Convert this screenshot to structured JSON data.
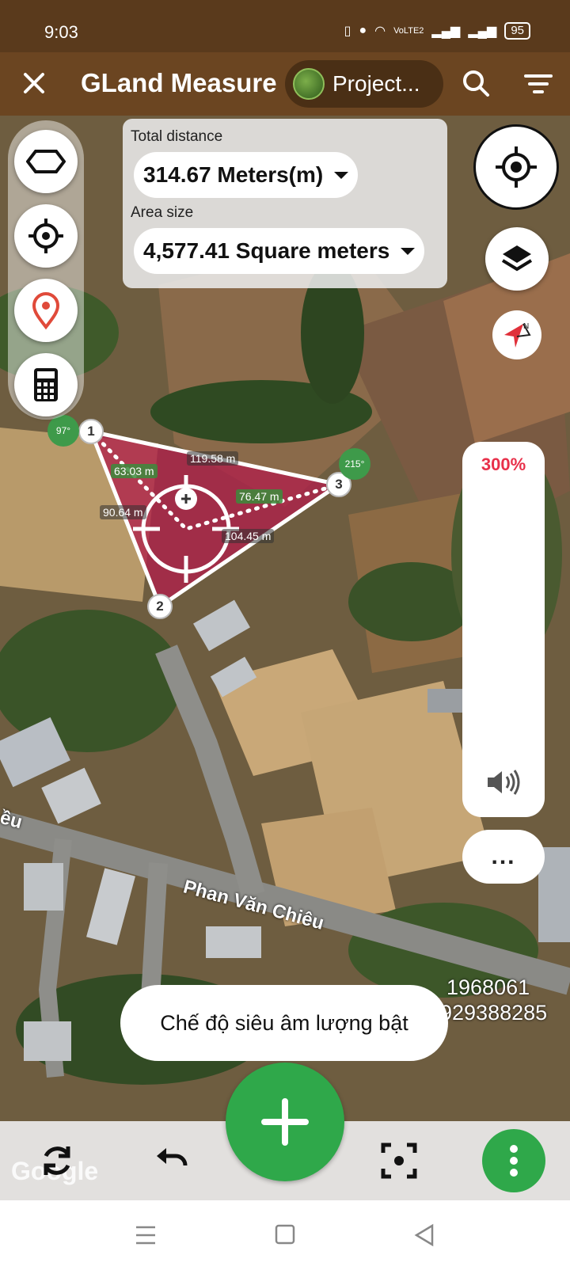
{
  "status_bar": {
    "time": "9:03",
    "network": "VoLTE2",
    "battery": "95"
  },
  "app_bar": {
    "title": "GLand Measure",
    "project_label": "Project..."
  },
  "measure": {
    "distance_label": "Total distance",
    "distance_value": "314.67 Meters(m)",
    "area_label": "Area size",
    "area_value": "4,577.41 Square meters"
  },
  "polygon": {
    "vertices": [
      {
        "label": "1",
        "angle": "97°"
      },
      {
        "label": "2",
        "angle": ""
      },
      {
        "label": "3",
        "angle": "215°"
      }
    ],
    "edge_lengths": [
      "119.58 m",
      "104.45 m",
      "90.64 m"
    ],
    "center_distances": [
      "63.03 m",
      "76.47 m"
    ]
  },
  "volume": {
    "percent": "300%"
  },
  "more_label": "...",
  "map_labels": {
    "road": "Phan Văn Chiêu",
    "road_partial": "ều",
    "phone_1": "1968061",
    "phone_2": "929388285",
    "google": "Google"
  },
  "toast": "Chế độ siêu âm lượng bật",
  "colors": {
    "brand": "#6b4521",
    "status_bar": "#5a3a1c",
    "polygon_fill": "#b0204a",
    "fab": "#2fa84a",
    "volume": "#e8304a"
  }
}
